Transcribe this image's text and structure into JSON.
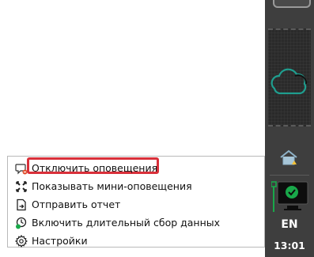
{
  "menu": {
    "items": [
      {
        "label": "Отключить оповещения",
        "icon": "notifications-off-icon"
      },
      {
        "label": "Показывать мини-оповещения",
        "icon": "mini-notifications-icon"
      },
      {
        "label": "Отправить отчет",
        "icon": "send-report-icon"
      },
      {
        "label": "Включить длительный сбор данных",
        "icon": "long-data-collection-icon"
      },
      {
        "label": "Настройки",
        "icon": "gear-icon"
      }
    ],
    "highlight_color": "#d9303a"
  },
  "taskbar": {
    "language": "EN",
    "clock": "13:01",
    "background": "#3e3e3e",
    "accent_green": "#19a84a",
    "accent_teal": "#1f9e8f"
  }
}
